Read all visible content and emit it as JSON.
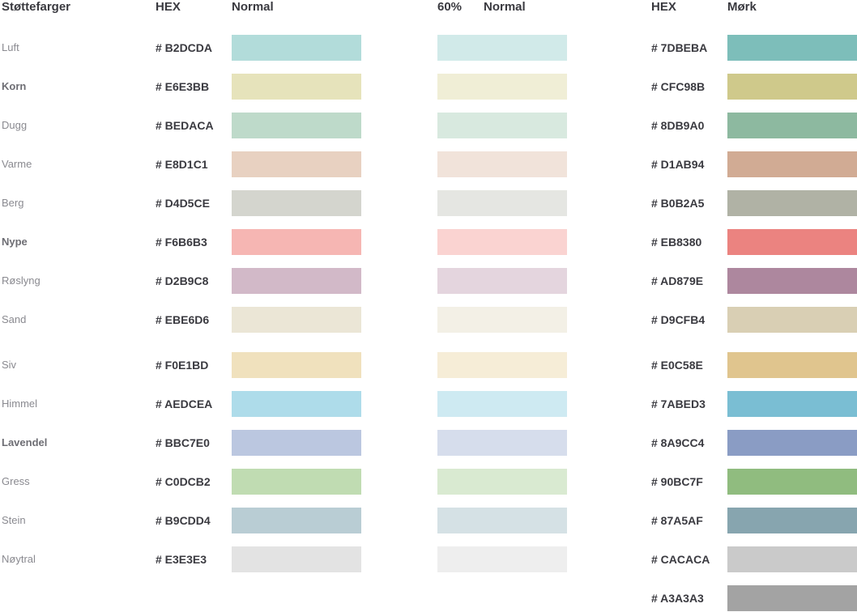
{
  "headers": {
    "stottefarger": "Støttefarger",
    "hex": "HEX",
    "normal": "Normal",
    "pct60": "60%",
    "normal2": "Normal",
    "hex2": "HEX",
    "mork": "Mørk"
  },
  "colors": [
    {
      "name": "Luft",
      "bold": false,
      "hex": "# B2DCDA",
      "normal": "#B2DCDA",
      "light": "#D1EAE9",
      "dark_hex": "# 7DBEBA",
      "dark": "#7DBEBA"
    },
    {
      "name": "Korn",
      "bold": true,
      "hex": "# E6E3BB",
      "normal": "#E6E3BB",
      "light": "#F0EED6",
      "dark_hex": "# CFC98B",
      "dark": "#CFC98B"
    },
    {
      "name": "Dugg",
      "bold": false,
      "hex": "# BEDACA",
      "normal": "#BEDACA",
      "light": "#D8E9DF",
      "dark_hex": "# 8DB9A0",
      "dark": "#8DB9A0"
    },
    {
      "name": "Varme",
      "bold": false,
      "hex": "# E8D1C1",
      "normal": "#E8D1C1",
      "light": "#F1E3DA",
      "dark_hex": "# D1AB94",
      "dark": "#D1AB94"
    },
    {
      "name": "Berg",
      "bold": false,
      "hex": "# D4D5CE",
      "normal": "#D4D5CE",
      "light": "#E5E6E2",
      "dark_hex": "# B0B2A5",
      "dark": "#B0B2A5"
    },
    {
      "name": "Nype",
      "bold": true,
      "hex": "# F6B6B3",
      "normal": "#F6B6B3",
      "light": "#FAD3D1",
      "dark_hex": "# EB8380",
      "dark": "#EB8380"
    },
    {
      "name": "Røslyng",
      "bold": false,
      "hex": "# D2B9C8",
      "normal": "#D2B9C8",
      "light": "#E4D5DE",
      "dark_hex": "# AD879E",
      "dark": "#AD879E"
    },
    {
      "name": "Sand",
      "bold": false,
      "hex": "# EBE6D6",
      "normal": "#EBE6D6",
      "light": "#F3F0E6",
      "dark_hex": "# D9CFB4",
      "dark": "#D9CFB4"
    },
    {
      "name": "Siv",
      "bold": false,
      "hex": "# F0E1BD",
      "normal": "#F0E1BD",
      "light": "#F6EDD7",
      "dark_hex": "# E0C58E",
      "dark": "#E0C58E"
    },
    {
      "name": "Himmel",
      "bold": false,
      "hex": "# AEDCEA",
      "normal": "#AEDCEA",
      "light": "#CEEAF2",
      "dark_hex": "# 7ABED3",
      "dark": "#7ABED3"
    },
    {
      "name": "Lavendel",
      "bold": true,
      "hex": "# BBC7E0",
      "normal": "#BBC7E0",
      "light": "#D6DDEC",
      "dark_hex": "# 8A9CC4",
      "dark": "#8A9CC4"
    },
    {
      "name": "Gress",
      "bold": false,
      "hex": "# C0DCB2",
      "normal": "#C0DCB2",
      "light": "#D9EAD1",
      "dark_hex": "# 90BC7F",
      "dark": "#90BC7F"
    },
    {
      "name": "Stein",
      "bold": false,
      "hex": "# B9CDD4",
      "normal": "#B9CDD4",
      "light": "#D5E1E5",
      "dark_hex": "# 87A5AF",
      "dark": "#87A5AF"
    },
    {
      "name": "Nøytral",
      "bold": false,
      "hex": "# E3E3E3",
      "normal": "#E3E3E3",
      "light": "#EEEEEE",
      "dark_hex": "# CACACA",
      "dark": "#CACACA"
    },
    {
      "name": "",
      "bold": false,
      "hex": "",
      "normal": "",
      "light": "",
      "dark_hex": "# A3A3A3",
      "dark": "#A3A3A3"
    }
  ]
}
